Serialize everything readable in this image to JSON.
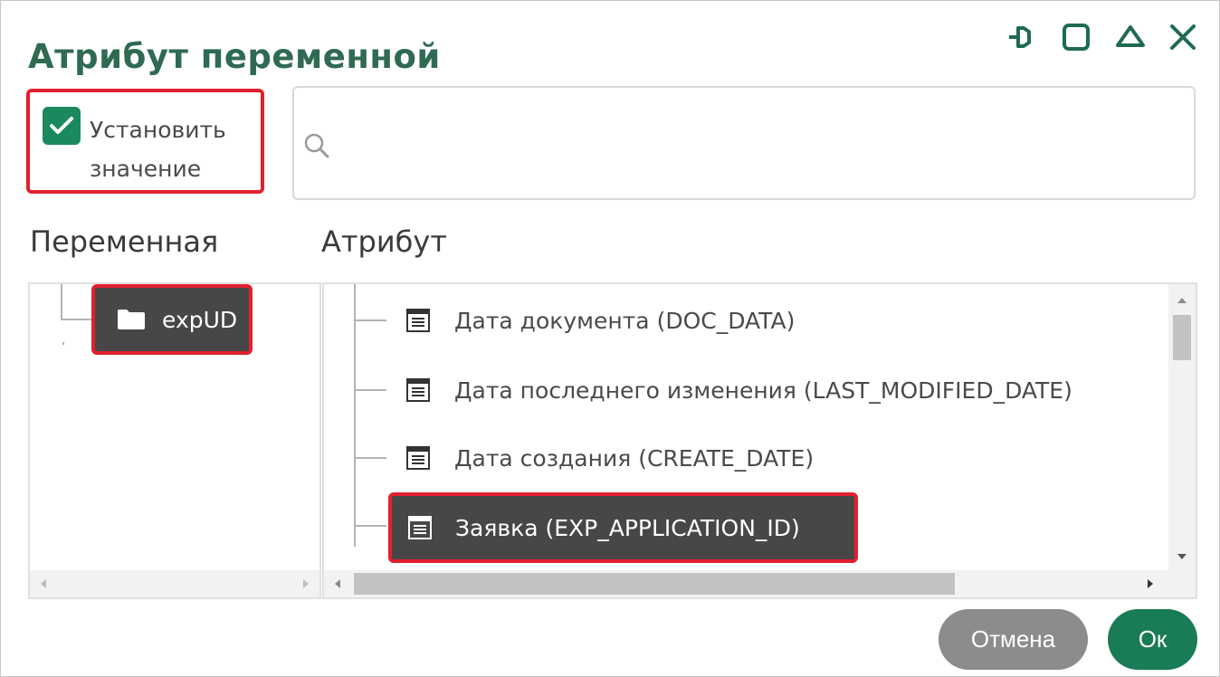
{
  "dialog": {
    "title": "Атрибут переменной"
  },
  "window_buttons": {
    "icons": [
      "pin-icon",
      "maximize-icon",
      "collapse-icon",
      "close-icon"
    ]
  },
  "set_value": {
    "checked": true,
    "label": "Установить значение"
  },
  "search": {
    "value": "",
    "placeholder": ""
  },
  "variable_panel": {
    "header": "Переменная",
    "items": [
      {
        "label": "expUD",
        "icon": "folder-icon",
        "selected": true
      }
    ]
  },
  "attribute_panel": {
    "header": "Атрибут",
    "items": [
      {
        "label": "Дата документа (DOC_DATA)",
        "icon": "table-icon",
        "selected": false
      },
      {
        "label": "Дата последнего изменения (LAST_MODIFIED_DATE)",
        "icon": "table-icon",
        "selected": false
      },
      {
        "label": "Дата создания (CREATE_DATE)",
        "icon": "table-icon",
        "selected": false
      },
      {
        "label": "Заявка (EXP_APPLICATION_ID)",
        "icon": "table-icon",
        "selected": true
      }
    ]
  },
  "buttons": {
    "cancel": "Отмена",
    "ok": "Ок"
  },
  "colors": {
    "accent_green": "#1a7b57",
    "title_green": "#2f6a53",
    "highlight_red": "#e1202f",
    "selected_bg": "#474747",
    "cancel_gray": "#8c8c8c"
  }
}
